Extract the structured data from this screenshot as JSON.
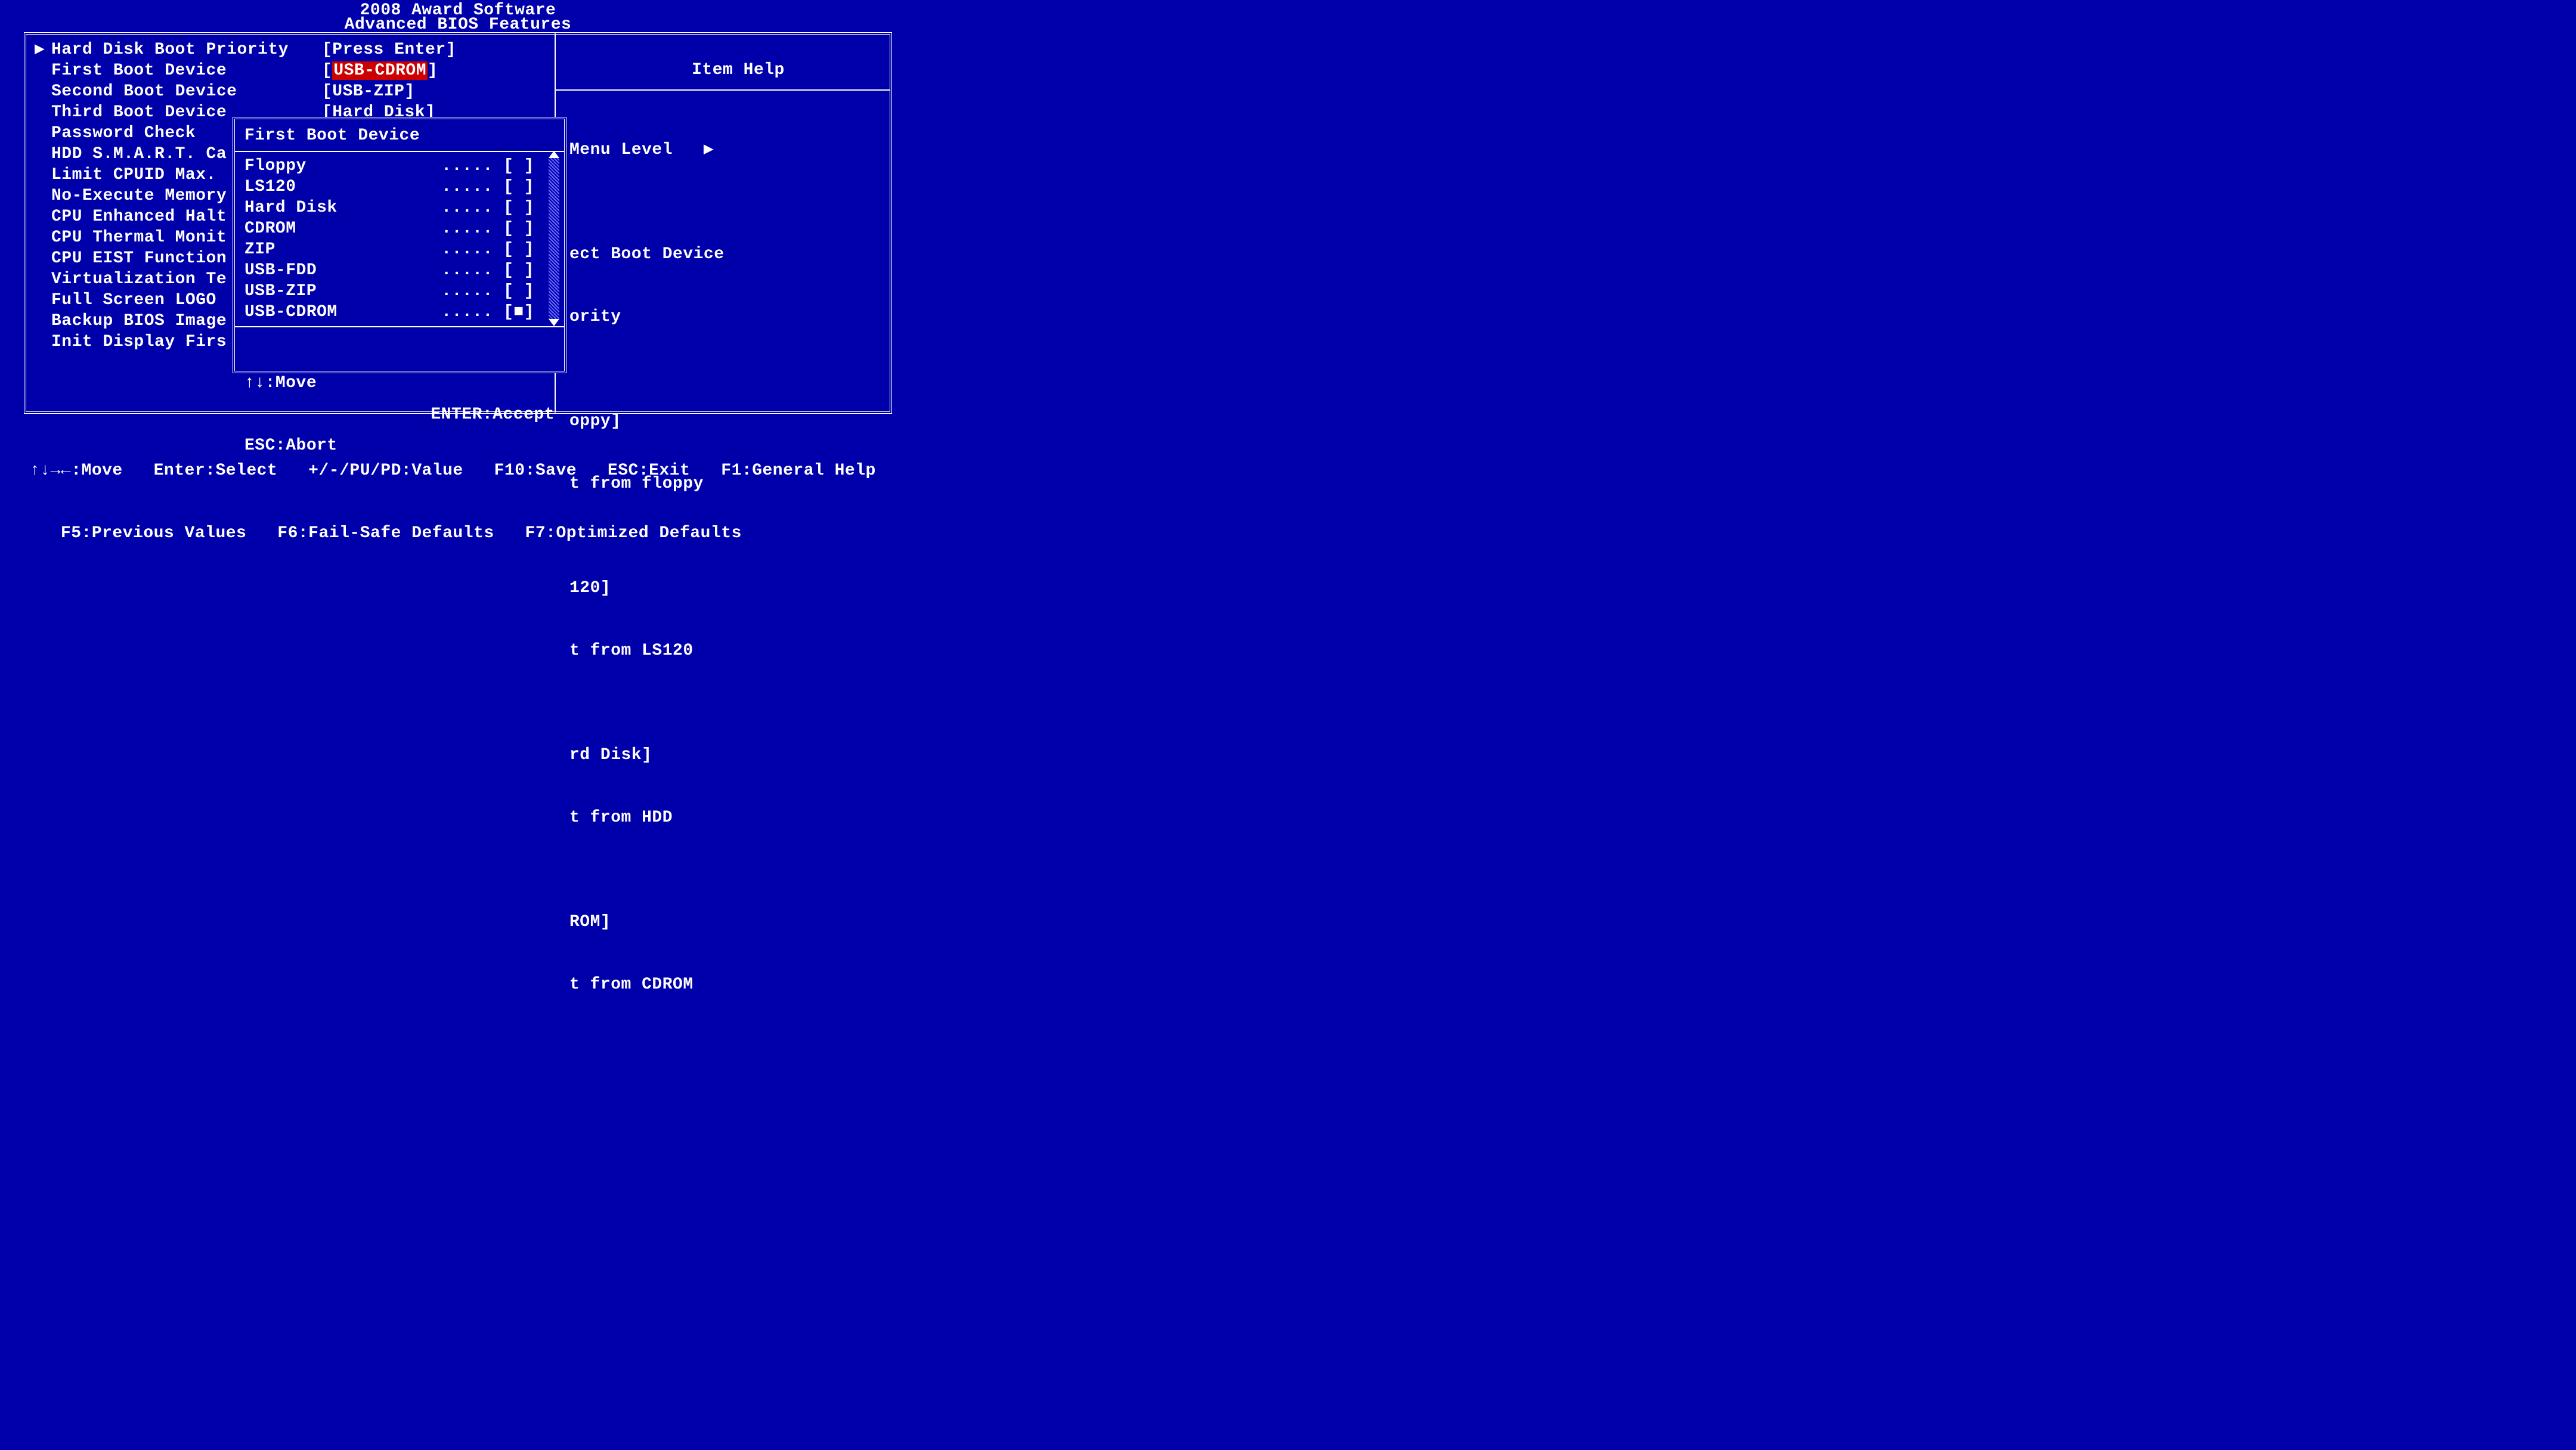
{
  "header": {
    "top": "2008 Award Software",
    "sub": "Advanced BIOS Features"
  },
  "settings": {
    "ptr": "▶",
    "items": [
      "Hard Disk Boot Priority",
      "First Boot Device",
      "Second Boot Device",
      "Third Boot Device",
      "Password Check",
      "HDD S.M.A.R.T. Ca",
      "Limit CPUID Max.",
      "No-Execute Memory",
      "CPU Enhanced Halt",
      "CPU Thermal Monit",
      "CPU EIST Function",
      "Virtualization Te",
      "Full Screen LOGO",
      "Backup BIOS Image",
      "Init Display Firs"
    ],
    "values": [
      "[Press Enter]",
      "[USB-CDROM]",
      "[USB-ZIP]",
      "[Hard Disk]"
    ],
    "highlighted_value_index": 1
  },
  "help": {
    "title": "Item Help",
    "menu_level": "Menu Level   ▶",
    "lines": [
      "",
      "ect Boot Device",
      "ority",
      "",
      "oppy]",
      "t from floppy",
      "",
      "120]",
      "t from LS120",
      "",
      "rd Disk]",
      "t from HDD",
      "",
      "ROM]",
      "t from CDROM"
    ]
  },
  "popup": {
    "title": "First Boot Device",
    "options": [
      {
        "label": "Floppy",
        "mark": "..... [ ]"
      },
      {
        "label": "LS120",
        "mark": "..... [ ]"
      },
      {
        "label": "Hard Disk",
        "mark": "..... [ ]"
      },
      {
        "label": "CDROM",
        "mark": "..... [ ]"
      },
      {
        "label": "ZIP",
        "mark": "..... [ ]"
      },
      {
        "label": "USB-FDD",
        "mark": "..... [ ]"
      },
      {
        "label": "USB-ZIP",
        "mark": "..... [ ]"
      },
      {
        "label": "USB-CDROM",
        "mark": "..... [■]"
      }
    ],
    "footer": {
      "move": "↑↓:Move",
      "abort": "ESC:Abort",
      "accept": "ENTER:Accept"
    }
  },
  "footer": {
    "line1": "↑↓→←:Move   Enter:Select   +/-/PU/PD:Value   F10:Save   ESC:Exit   F1:General Help",
    "line2": "   F5:Previous Values   F6:Fail-Safe Defaults   F7:Optimized Defaults"
  }
}
